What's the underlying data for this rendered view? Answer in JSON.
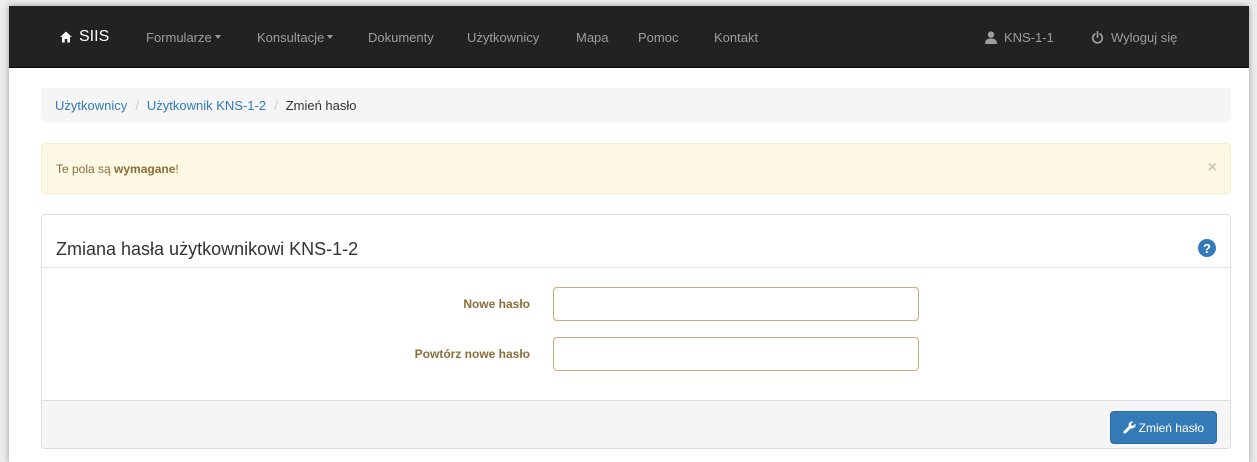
{
  "navbar": {
    "brand": "SIIS",
    "brand_icon": "home-icon",
    "items": [
      {
        "label": "Formularze",
        "dropdown": true
      },
      {
        "label": "Konsultacje",
        "dropdown": true
      },
      {
        "label": "Dokumenty",
        "dropdown": false
      },
      {
        "label": "Użytkownicy",
        "dropdown": false
      },
      {
        "label": "Mapa",
        "dropdown": false
      },
      {
        "label": "Pomoc",
        "dropdown": false
      },
      {
        "label": "Kontakt",
        "dropdown": false
      }
    ],
    "user": {
      "label": "KNS-1-1",
      "icon": "user-icon"
    },
    "logout": {
      "label": "Wyloguj się",
      "icon": "power-icon"
    }
  },
  "breadcrumb": {
    "items": [
      "Użytkownicy",
      "Użytkownik KNS-1-2"
    ],
    "separator": "/",
    "active": "Zmień hasło"
  },
  "alert": {
    "prefix": "Te pola są ",
    "strong": "wymagane",
    "suffix": "!",
    "close": "×"
  },
  "panel": {
    "title": "Zmiana hasła użytkownikowi KNS-1-2",
    "help_icon": "?",
    "fields": [
      {
        "label": "Nowe hasło",
        "value": "",
        "placeholder": ""
      },
      {
        "label": "Powtórz nowe hasło",
        "value": "",
        "placeholder": ""
      }
    ],
    "submit_label": "Zmień hasło",
    "submit_icon": "wrench-icon"
  },
  "colors": {
    "navbar_bg": "#222222",
    "nav_text": "#9d9d9d",
    "link": "#337ab7",
    "warning_text": "#8a6d3b",
    "warning_bg": "#fcf8e3",
    "primary": "#337ab7"
  }
}
